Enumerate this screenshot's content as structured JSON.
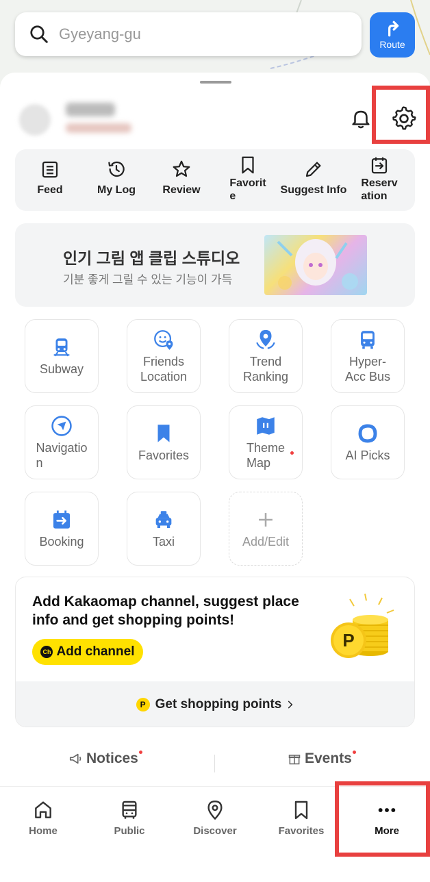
{
  "search": {
    "placeholder": "Gyeyang-gu"
  },
  "route_button": {
    "label": "Route"
  },
  "quick_menu": [
    {
      "label": "Feed",
      "icon": "feed-icon"
    },
    {
      "label": "My Log",
      "icon": "history-icon"
    },
    {
      "label": "Review",
      "icon": "star-icon"
    },
    {
      "label": "Favorit\ne",
      "icon": "bookmark-icon"
    },
    {
      "label": "Suggest Info",
      "icon": "pencil-icon"
    },
    {
      "label": "Reserv\nation",
      "icon": "calendar-arrow-icon"
    }
  ],
  "banner": {
    "title": "인기 그림 앱 클립 스튜디오",
    "subtitle": "기분 좋게 그릴 수 있는 기능이 가득"
  },
  "tiles": [
    {
      "label": "Subway",
      "icon": "subway-icon"
    },
    {
      "label": "Friends\nLocation",
      "icon": "friends-location-icon"
    },
    {
      "label": "Trend\nRanking",
      "icon": "trend-pin-icon"
    },
    {
      "label": "Hyper-\nAcc Bus",
      "icon": "bus-icon"
    },
    {
      "label": "Navigatio\nn",
      "icon": "navigation-icon"
    },
    {
      "label": "Favorites",
      "icon": "bookmark-icon"
    },
    {
      "label": "Theme\nMap",
      "icon": "map-icon"
    },
    {
      "label": "AI Picks",
      "icon": "ai-picks-icon"
    },
    {
      "label": "Booking",
      "icon": "booking-icon"
    },
    {
      "label": "Taxi",
      "icon": "taxi-icon"
    },
    {
      "label": "Add/Edit",
      "icon": "plus-icon"
    }
  ],
  "promo": {
    "text": "Add Kakaomap channel, suggest place info and get shopping points!",
    "button_label": "Add channel",
    "channel_badge": "Ch",
    "footer": "Get shopping points",
    "footer_badge": "P",
    "coin_letter": "P"
  },
  "links": {
    "notices": "Notices",
    "events": "Events"
  },
  "tabs": [
    {
      "label": "Home",
      "icon": "home-icon"
    },
    {
      "label": "Public",
      "icon": "bus-icon"
    },
    {
      "label": "Discover",
      "icon": "location-pin-icon"
    },
    {
      "label": "Favorites",
      "icon": "bookmark-icon"
    },
    {
      "label": "More",
      "icon": "more-dots-icon"
    }
  ],
  "colors": {
    "accent": "#2b7df0",
    "highlight_box": "#e8403f",
    "kakao_yellow": "#ffe100"
  }
}
